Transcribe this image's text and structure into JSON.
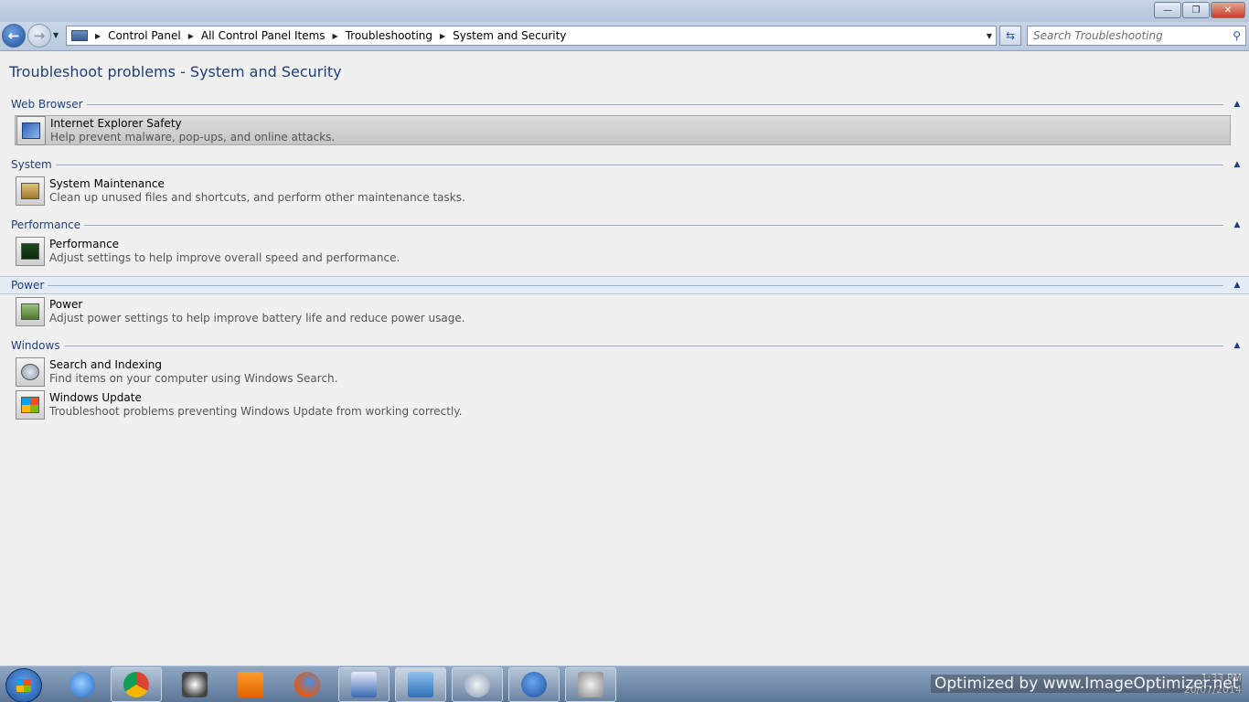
{
  "window": {
    "minimize": "—",
    "maximize": "❐",
    "close": "✕"
  },
  "nav": {
    "breadcrumbs": [
      "Control Panel",
      "All Control Panel Items",
      "Troubleshooting",
      "System and Security"
    ],
    "search_placeholder": "Search Troubleshooting"
  },
  "page": {
    "title": "Troubleshoot problems - System and Security"
  },
  "groups": [
    {
      "name": "Web Browser",
      "items": [
        {
          "title": "Internet Explorer Safety",
          "desc": "Help prevent malware, pop-ups, and online attacks.",
          "icon": "shield-icon"
        }
      ]
    },
    {
      "name": "System",
      "items": [
        {
          "title": "System Maintenance",
          "desc": "Clean up unused files and shortcuts, and perform other maintenance tasks.",
          "icon": "maintenance-icon"
        }
      ]
    },
    {
      "name": "Performance",
      "items": [
        {
          "title": "Performance",
          "desc": "Adjust settings to help improve overall speed and performance.",
          "icon": "performance-monitor-icon"
        }
      ]
    },
    {
      "name": "Power",
      "items": [
        {
          "title": "Power",
          "desc": "Adjust power settings to help improve battery life and reduce power usage.",
          "icon": "power-icon"
        }
      ]
    },
    {
      "name": "Windows",
      "items": [
        {
          "title": "Search and Indexing",
          "desc": "Find items on your computer using Windows Search.",
          "icon": "search-indexing-icon"
        },
        {
          "title": "Windows Update",
          "desc": "Troubleshoot problems preventing Windows Update from working correctly.",
          "icon": "windows-update-icon"
        }
      ]
    }
  ],
  "taskbar": {
    "apps": [
      "internet-explorer-icon",
      "chrome-icon",
      "network-icon",
      "vlc-icon",
      "firefox-icon",
      "word-icon",
      "control-panel-icon",
      "troubleshooting-icon",
      "help-icon",
      "search-indexing-icon"
    ],
    "clock": "1:33 PM",
    "date": "20/07/2014"
  },
  "watermark": "Optimized by www.ImageOptimizer.net",
  "colors": {
    "accent": "#1e3f7a",
    "selected_row": "#c6c6c6",
    "taskbar": "#6d86a6"
  }
}
